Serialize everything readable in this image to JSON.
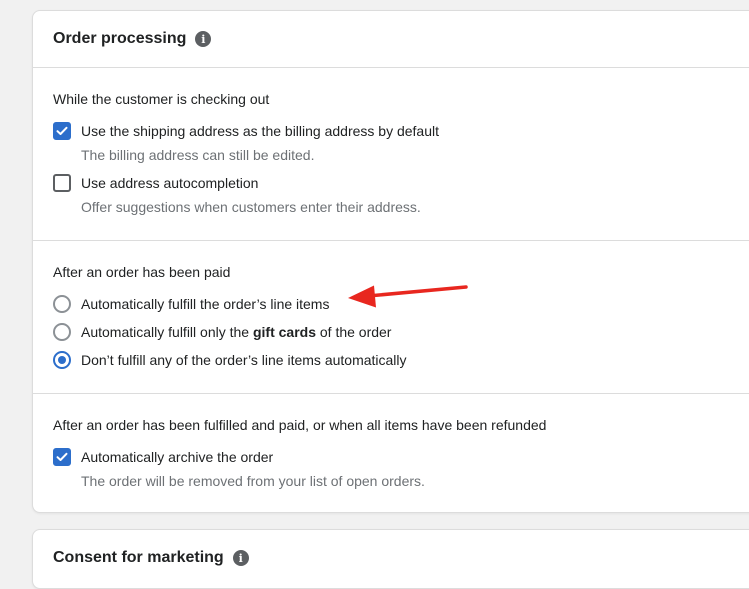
{
  "order_processing": {
    "title": "Order processing",
    "checkout_section": {
      "heading": "While the customer is checking out",
      "options": [
        {
          "label": "Use the shipping address as the billing address by default",
          "help": "The billing address can still be edited.",
          "checked": true
        },
        {
          "label": "Use address autocompletion",
          "help": "Offer suggestions when customers enter their address.",
          "checked": false
        }
      ]
    },
    "paid_section": {
      "heading": "After an order has been paid",
      "options": [
        {
          "label": "Automatically fulfill the order’s line items",
          "selected": false
        },
        {
          "label_before": "Automatically fulfill only the ",
          "label_bold": "gift cards",
          "label_after": " of the order",
          "selected": false
        },
        {
          "label": "Don’t fulfill any of the order’s line items automatically",
          "selected": true
        }
      ]
    },
    "fulfilled_section": {
      "heading": "After an order has been fulfilled and paid, or when all items have been refunded",
      "options": [
        {
          "label": "Automatically archive the order",
          "help": "The order will be removed from your list of open orders.",
          "checked": true
        }
      ]
    }
  },
  "consent_card": {
    "title": "Consent for marketing"
  },
  "colors": {
    "accent": "#2c6ecb",
    "annotation_arrow": "#e8271f"
  },
  "icons": {
    "info": "info-icon",
    "checkmark": "checkmark-icon",
    "arrow": "annotation-arrow"
  }
}
